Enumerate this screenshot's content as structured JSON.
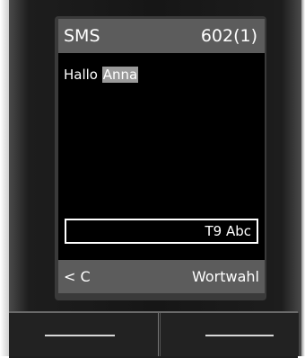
{
  "header": {
    "title": "SMS",
    "counter": "602(1)"
  },
  "message": {
    "text_before": "Hallo ",
    "highlighted_word": "Anna"
  },
  "input_mode": {
    "label": "T9 Abc"
  },
  "softkeys": {
    "left_label": "< C",
    "right_label": "Wortwahl"
  },
  "colors": {
    "screen_background": "#000000",
    "bar_background": "#5c5c5c",
    "highlight_background": "#9a9a9a",
    "text": "#ffffff"
  }
}
